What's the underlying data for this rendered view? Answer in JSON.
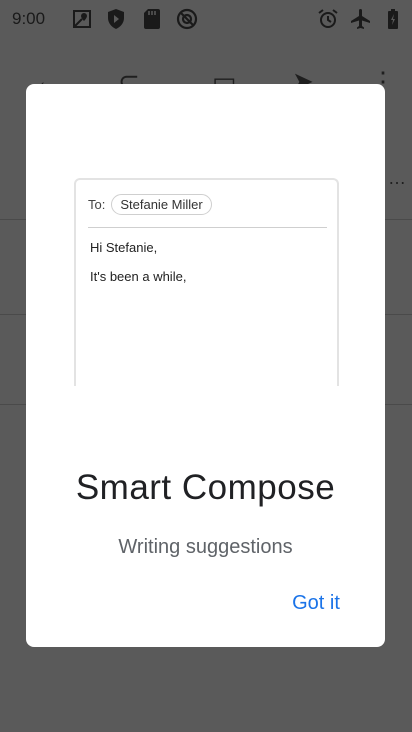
{
  "status_bar": {
    "time": "9:00",
    "left_icons": [
      "maps-icon",
      "shield-icon",
      "sd-card-icon",
      "vpn-icon"
    ],
    "right_icons": [
      "alarm-icon",
      "airplane-icon",
      "battery-icon"
    ]
  },
  "dialog": {
    "preview": {
      "to_label": "To:",
      "recipient": "Stefanie Miller",
      "line1": "Hi Stefanie,",
      "line2": "It's been a while,"
    },
    "title": "Smart Compose",
    "subtitle": "Writing suggestions",
    "action_label": "Got it"
  },
  "colors": {
    "accent": "#1a73e8",
    "scrim": "#5a5a5a"
  }
}
